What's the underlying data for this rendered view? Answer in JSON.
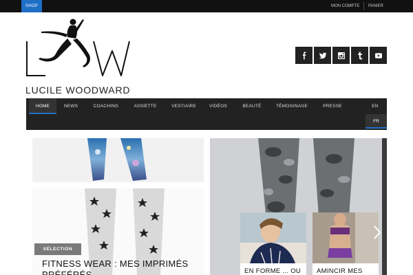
{
  "topbar": {
    "shop_label": "SHOP",
    "account_label": "MON COMPTE",
    "cart_label": "PANIER"
  },
  "logo": {
    "text": "LUCILE WOODWARD",
    "brand_color": "#1e6fc6"
  },
  "social": [
    {
      "name": "facebook-icon",
      "glyph": "f"
    },
    {
      "name": "twitter-icon",
      "glyph": ""
    },
    {
      "name": "instagram-icon",
      "glyph": ""
    },
    {
      "name": "tumblr-icon",
      "glyph": "t"
    },
    {
      "name": "youtube-icon",
      "glyph": ""
    }
  ],
  "nav": {
    "items": [
      {
        "label": "HOME",
        "active": true
      },
      {
        "label": "NEWS"
      },
      {
        "label": "COACHING"
      },
      {
        "label": "ASSIETTE"
      },
      {
        "label": "VESTIAIRE"
      },
      {
        "label": "VIDÉOS"
      },
      {
        "label": "BEAUTÉ"
      },
      {
        "label": "TÉMOIGNAGE"
      },
      {
        "label": "PRESSE"
      },
      {
        "label": "EN"
      }
    ],
    "lang_active": "FR"
  },
  "featured": {
    "badge": "SÉLECTION",
    "title": "FITNESS WEAR : MES IMPRIMÉS PRÉFÉRÉS"
  },
  "cards": [
    {
      "caption": "EN FORME ... OU"
    },
    {
      "caption": "AMINCIR MES"
    }
  ]
}
